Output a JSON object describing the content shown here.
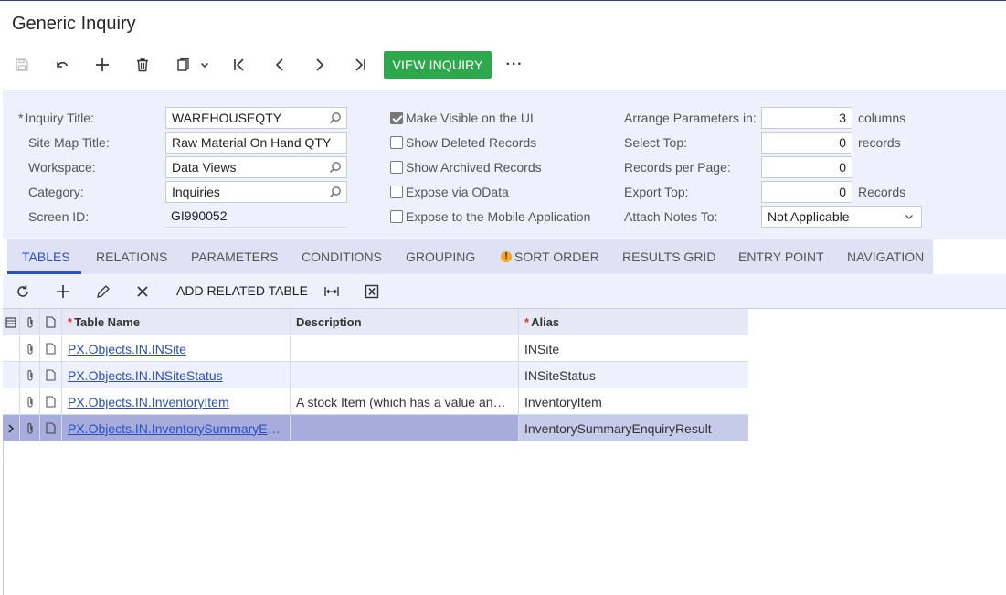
{
  "page": {
    "title": "Generic Inquiry"
  },
  "toolbar": {
    "view_inquiry_label": "VIEW INQUIRY",
    "more_label": "···"
  },
  "form": {
    "inquiry_title_label": "Inquiry Title:",
    "inquiry_title_value": "WAREHOUSEQTY",
    "site_map_title_label": "Site Map Title:",
    "site_map_title_value": "Raw Material On Hand QTY",
    "workspace_label": "Workspace:",
    "workspace_value": "Data Views",
    "category_label": "Category:",
    "category_value": "Inquiries",
    "screen_id_label": "Screen ID:",
    "screen_id_value": "GI990052",
    "required_mark": "*",
    "checkboxes": [
      {
        "label": "Make Visible on the UI",
        "checked": true
      },
      {
        "label": "Show Deleted Records",
        "checked": false
      },
      {
        "label": "Show Archived Records",
        "checked": false
      },
      {
        "label": "Expose via OData",
        "checked": false
      },
      {
        "label": "Expose to the Mobile Application",
        "checked": false
      }
    ],
    "arrange_label": "Arrange Parameters in:",
    "arrange_value": "3",
    "arrange_unit": "columns",
    "select_top_label": "Select Top:",
    "select_top_value": "0",
    "select_top_unit": "records",
    "records_per_page_label": "Records per Page:",
    "records_per_page_value": "0",
    "export_top_label": "Export Top:",
    "export_top_value": "0",
    "export_top_unit": "Records",
    "attach_notes_label": "Attach Notes To:",
    "attach_notes_value": "Not Applicable"
  },
  "tabs": [
    {
      "label": "TABLES",
      "active": true
    },
    {
      "label": "RELATIONS"
    },
    {
      "label": "PARAMETERS"
    },
    {
      "label": "CONDITIONS"
    },
    {
      "label": "GROUPING"
    },
    {
      "label": "SORT ORDER",
      "warning": true
    },
    {
      "label": "RESULTS GRID"
    },
    {
      "label": "ENTRY POINT"
    },
    {
      "label": "NAVIGATION"
    }
  ],
  "grid_toolbar": {
    "add_related_label": "ADD RELATED TABLE"
  },
  "grid": {
    "columns": {
      "table_name": "Table Name",
      "description": "Description",
      "alias": "Alias"
    },
    "rows": [
      {
        "table_name": "PX.Objects.IN.INSite",
        "description": "",
        "alias": "INSite"
      },
      {
        "table_name": "PX.Objects.IN.INSiteStatus",
        "description": "",
        "alias": "INSiteStatus"
      },
      {
        "table_name": "PX.Objects.IN.InventoryItem",
        "description": "A stock Item (which has a value and i...",
        "alias": "InventoryItem"
      },
      {
        "table_name": "PX.Objects.IN.InventorySummaryEnq...",
        "description": "",
        "alias": "InventorySummaryEnquiryResult"
      }
    ]
  },
  "colors": {
    "accent": "#2b4fbf",
    "primary_button": "#2ea84c",
    "selected_row": "#a6acdc",
    "panel_bg": "#eef0fb"
  }
}
